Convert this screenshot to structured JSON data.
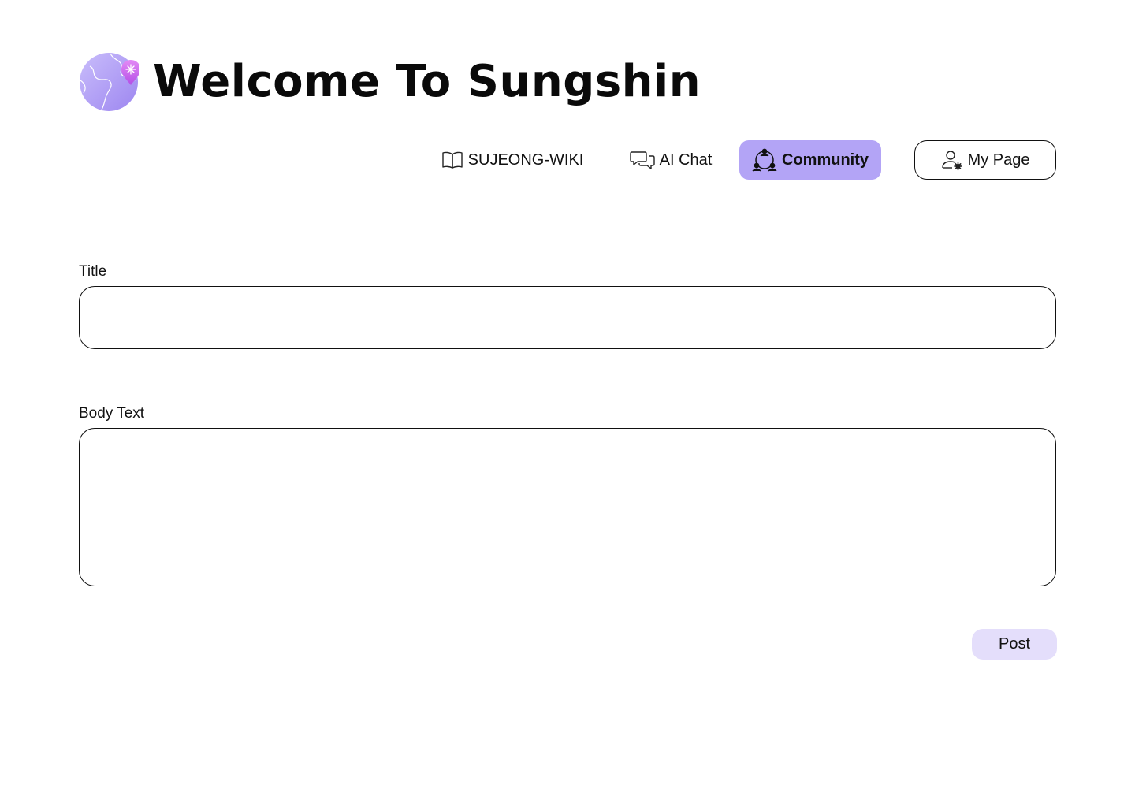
{
  "header": {
    "title": "Welcome To Sungshin",
    "logo_icon": "globe-pin-icon",
    "accent_color": "#b3a4f6"
  },
  "nav": {
    "items": [
      {
        "label": "SUJEONG-WIKI",
        "icon": "book-icon",
        "active": false
      },
      {
        "label": "AI Chat",
        "icon": "chat-bubbles-icon",
        "active": false
      },
      {
        "label": "Community",
        "icon": "community-icon",
        "active": true
      },
      {
        "label": "My Page",
        "icon": "user-settings-icon",
        "active": false
      }
    ]
  },
  "form": {
    "title_label": "Title",
    "title_value": "",
    "body_label": "Body Text",
    "body_value": "",
    "post_label": "Post",
    "post_color": "#e4defb"
  }
}
